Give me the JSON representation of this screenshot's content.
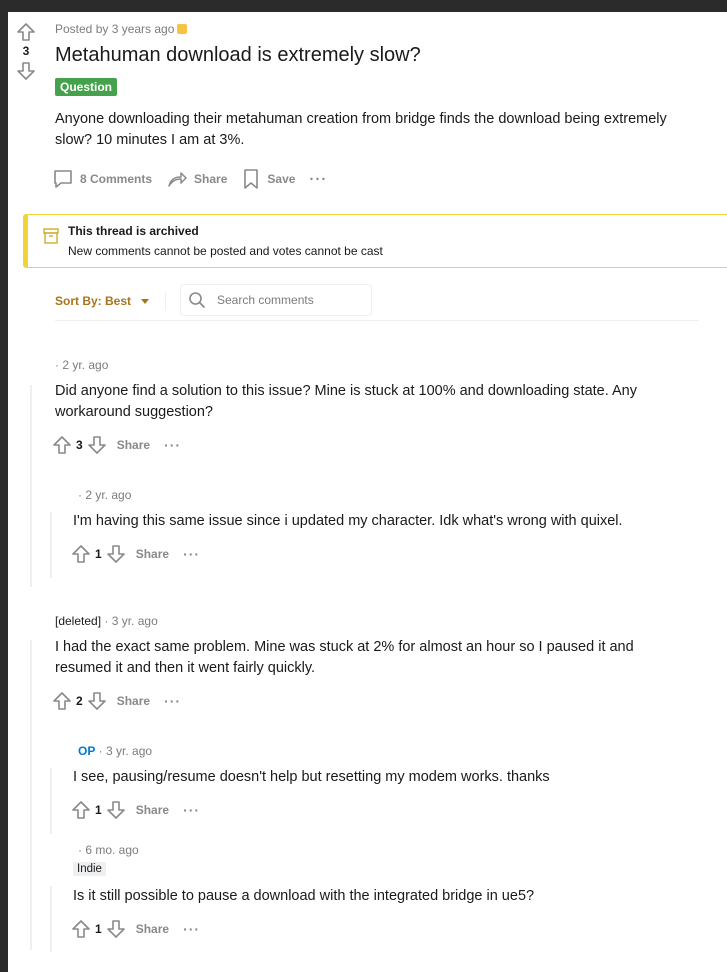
{
  "post": {
    "score": "3",
    "posted_by": "Posted by 3 years ago",
    "title": "Metahuman download is extremely slow?",
    "flair": "Question",
    "body": "Anyone downloading their metahuman creation from bridge finds the download being extremely slow? 10 minutes I am at 3%.",
    "comments_label": "8 Comments",
    "share_label": "Share",
    "save_label": "Save",
    "more_label": "···"
  },
  "archived": {
    "heading": "This thread is archived",
    "subtext": "New comments cannot be posted and votes cannot be cast"
  },
  "sort": {
    "label": "Sort By: Best",
    "search_placeholder": "Search comments"
  },
  "comments": [
    {
      "meta": "· 2 yr. ago",
      "text": "Did anyone find a solution to this issue? Mine is stuck at 100% and downloading state. Any workaround suggestion?",
      "score": "3",
      "share": "Share",
      "more": "···"
    },
    {
      "meta": "· 2 yr. ago",
      "text": "I'm having this same issue since i updated my character. Idk what's wrong with quixel.",
      "score": "1",
      "share": "Share",
      "more": "···"
    },
    {
      "author": "[deleted]",
      "meta": " · 3 yr. ago",
      "text": "I had the exact same problem. Mine was stuck at 2% for almost an hour so I paused it and resumed it and then it went fairly quickly.",
      "score": "2",
      "share": "Share",
      "more": "···"
    },
    {
      "author_badge": "OP",
      "meta": " · 3 yr. ago",
      "text": "I see, pausing/resume doesn't help but resetting my modem works. thanks",
      "score": "1",
      "share": "Share",
      "more": "···"
    },
    {
      "meta": "· 6 mo. ago",
      "flair": "Indie",
      "text": "Is it still possible to pause a download with the integrated bridge in ue5?",
      "score": "1",
      "share": "Share",
      "more": "···"
    }
  ],
  "colors": {
    "flair_bg": "#46a14c",
    "archived_border": "#f0d438",
    "sort_accent": "#a8741a",
    "op_blue": "#0079d3"
  }
}
